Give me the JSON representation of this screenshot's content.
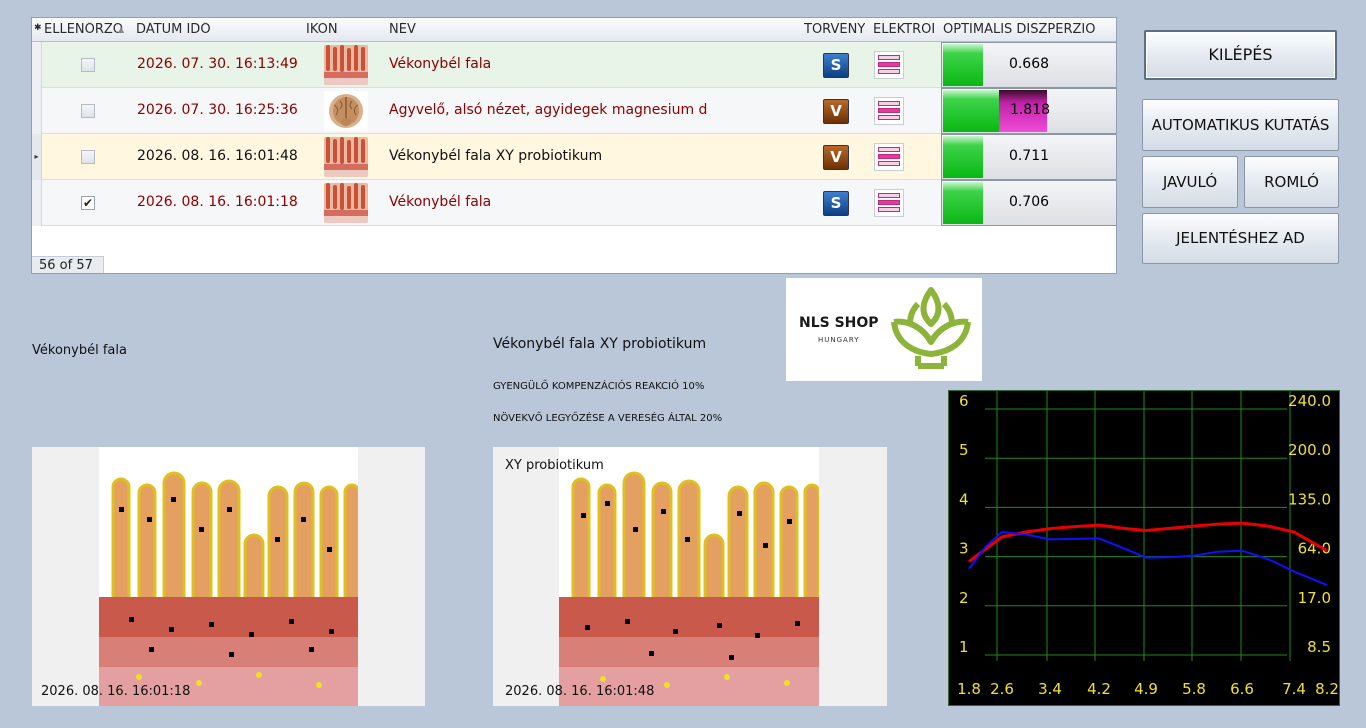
{
  "grid": {
    "columns": [
      "ELLENŐRZÖ",
      "DÁTUM IDŐ",
      "IKON",
      "NÉV",
      "TÖRVÉNY",
      "ELEKTROI",
      "OPTIMÁLIS DISZPERZIÓ"
    ],
    "rows": [
      {
        "date": "2026. 07. 30. 16:13:49",
        "name": "Vékonybél fala",
        "law": "S",
        "dispersion": "0.668",
        "checked": false,
        "icon": "intestine-wall-icon"
      },
      {
        "date": "2026. 07. 30. 16:25:36",
        "name": "Agyvelő, alsó nézet, agyidegek magnesium d",
        "law": "V",
        "dispersion": "1.818",
        "checked": false,
        "icon": "brain-icon"
      },
      {
        "date": "2026. 08. 16. 16:01:48",
        "name": "Vékonybél fala XY probiotikum",
        "law": "V",
        "dispersion": "0.711",
        "checked": false,
        "icon": "intestine-wall-icon"
      },
      {
        "date": "2026. 08. 16. 16:01:18",
        "name": "Vékonybél fala",
        "law": "S",
        "dispersion": "0.706",
        "checked": true,
        "icon": "intestine-wall-icon"
      }
    ],
    "pager": "56 of 57"
  },
  "buttons": {
    "exit": "KILÉPÉS",
    "auto": "AUTOMATIKUS KUTATÁS",
    "improving": "JAVULÓ",
    "worsening": "ROMLÓ",
    "report": "JELENTÉSHEZ AD"
  },
  "left_panel": {
    "title": "Vékonybél fala",
    "timestamp": "2026. 08. 16. 16:01:18"
  },
  "right_panel": {
    "title": "Vékonybél fala XY probiotikum",
    "note1": "GYENGÜLŐ KOMPENZÁCIÓS REAKCIÓ 10%",
    "note2": "NÖVEKVŐ LEGYŐZÉSE A VERESÉG ÁLTAL 20%",
    "overlay": "XY probiotikum",
    "timestamp": "2026. 08. 16. 16:01:48"
  },
  "logo": {
    "text": "NLS SHOP",
    "sub": "HUNGARY",
    "color": "#8db43a"
  },
  "chart_data": {
    "type": "line",
    "x_ticks": [
      "1.8",
      "2.6",
      "3.4",
      "4.2",
      "4.9",
      "5.8",
      "6.6",
      "7.4",
      "8.2"
    ],
    "y_left_ticks": [
      "1",
      "2",
      "3",
      "4",
      "5",
      "6"
    ],
    "y_right_ticks": [
      "8.5",
      "17.0",
      "64.0",
      "135.0",
      "200.0",
      "240.0"
    ],
    "ylim": [
      1,
      6
    ],
    "grid": true,
    "series": [
      {
        "color": "#e80000",
        "x": [
          1.8,
          2.2,
          2.6,
          3.0,
          3.4,
          3.8,
          4.2,
          4.6,
          4.9,
          5.4,
          5.8,
          6.2,
          6.6,
          7.0,
          7.4,
          8.2
        ],
        "y": [
          2.9,
          3.15,
          3.4,
          3.5,
          3.57,
          3.61,
          3.64,
          3.57,
          3.53,
          3.58,
          3.62,
          3.66,
          3.68,
          3.62,
          3.5,
          3.12
        ]
      },
      {
        "color": "#1010ff",
        "x": [
          1.8,
          2.2,
          2.6,
          3.0,
          3.4,
          3.8,
          4.2,
          4.6,
          4.9,
          5.4,
          5.8,
          6.2,
          6.6,
          7.0,
          7.4,
          8.2
        ],
        "y": [
          2.75,
          3.2,
          3.5,
          3.45,
          3.35,
          3.36,
          3.37,
          3.15,
          2.98,
          2.99,
          3.02,
          3.1,
          3.12,
          2.95,
          2.7,
          2.42
        ]
      }
    ]
  }
}
